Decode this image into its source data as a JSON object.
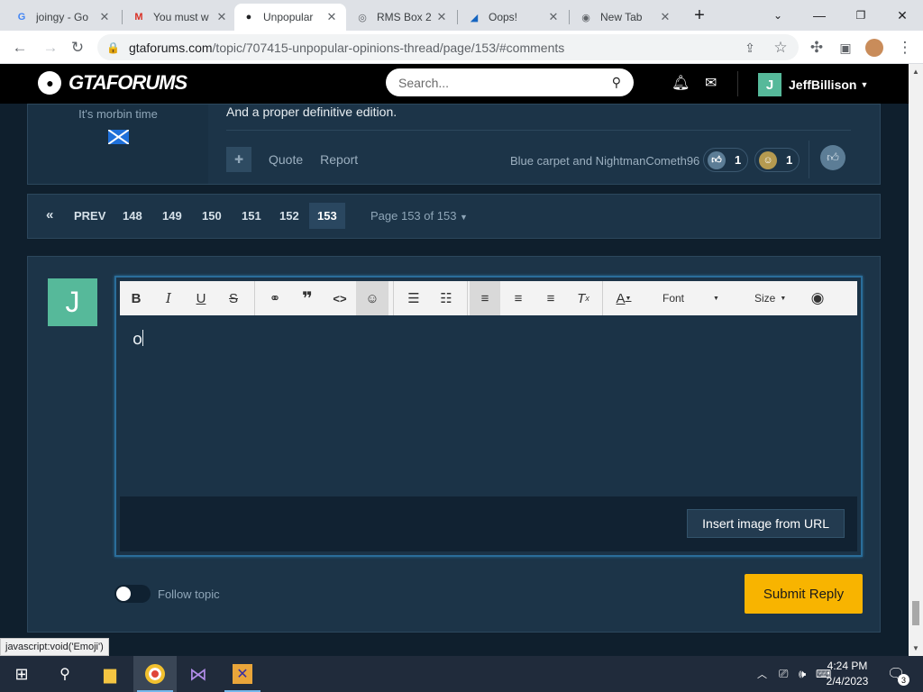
{
  "browser": {
    "tabs": [
      {
        "title": "joingy - Go",
        "favicon": "G"
      },
      {
        "title": "You must w",
        "favicon": "M"
      },
      {
        "title": "Unpopular",
        "favicon": "●"
      },
      {
        "title": "RMS Box 2",
        "favicon": "◎"
      },
      {
        "title": "Oops!",
        "favicon": "◢"
      },
      {
        "title": "New Tab",
        "favicon": "◉"
      }
    ],
    "url_host": "gtaforums.com",
    "url_path": "/topic/707415-unpopular-opinions-thread/page/153/#comments"
  },
  "site": {
    "logo": "GTAFORUMS",
    "search_placeholder": "Search...",
    "username": "JeffBillison",
    "user_initial": "J"
  },
  "post": {
    "member_title": "It's morbin time",
    "text": "And a proper definitive edition.",
    "quote_label": "Quote",
    "report_label": "Report",
    "reacted_by": "Blue carpet and NightmanCometh96",
    "reaction_like_count": "1",
    "reaction_face_count": "1"
  },
  "pagination": {
    "prev_label": "PREV",
    "pages": [
      "148",
      "149",
      "150",
      "151",
      "152",
      "153"
    ],
    "current": "153",
    "page_info": "Page 153 of 153"
  },
  "reply": {
    "avatar_initial": "J",
    "toolbar": {
      "font_label": "Font",
      "size_label": "Size"
    },
    "typed_text": "o",
    "insert_image_label": "Insert image from URL",
    "follow_label": "Follow topic",
    "submit_label": "Submit Reply"
  },
  "status_bar": "javascript:void('Emoji')",
  "clock": {
    "time": "4:24 PM",
    "date": "2/4/2023"
  },
  "notification_count": "3",
  "colors": {
    "accent": "#f8b400",
    "avatar": "#56b99a",
    "panel": "#1c3448",
    "background": "#0f1f2d"
  }
}
